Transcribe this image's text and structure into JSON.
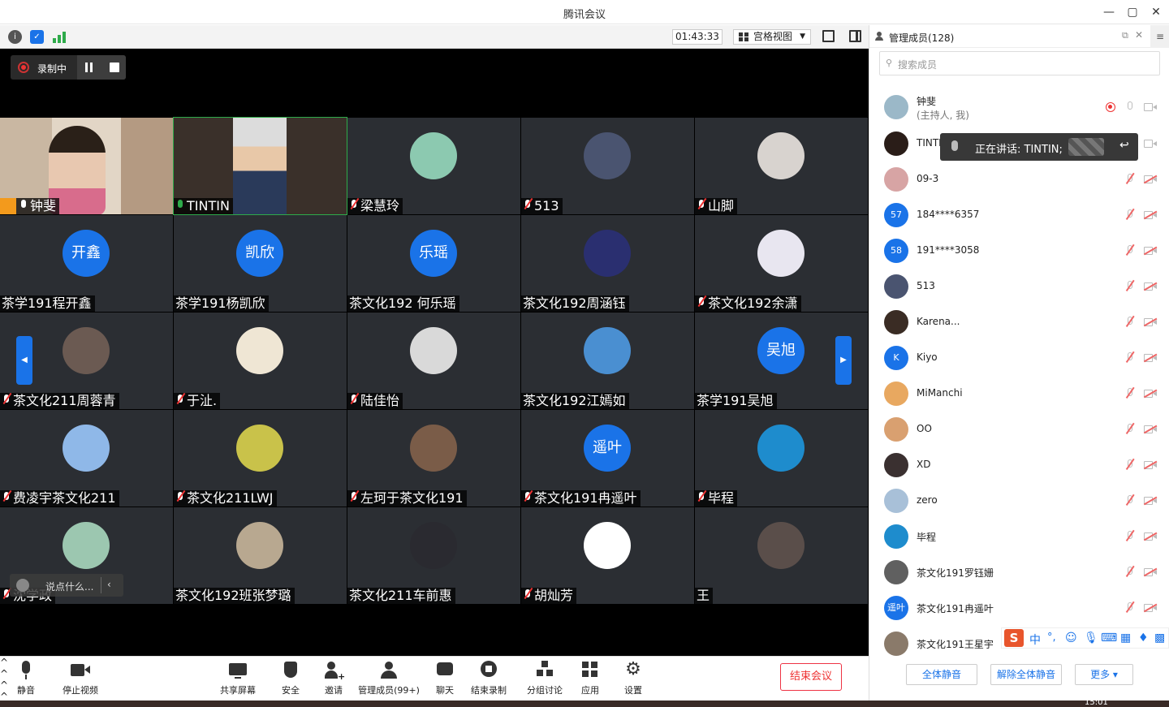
{
  "window": {
    "title": "腾讯会议",
    "controls": [
      "—",
      "▢",
      "✕"
    ]
  },
  "toolbar": {
    "timer": "01:43:33",
    "view_mode": "宫格视图"
  },
  "recording": {
    "label": "录制中"
  },
  "tiles": [
    {
      "name": "钟斐",
      "type": "video",
      "host": true,
      "mic": "on"
    },
    {
      "name": "TINTIN",
      "type": "video",
      "mic": "speaking",
      "active": true
    },
    {
      "name": "梁慧玲",
      "type": "photo",
      "color": "#8cc9b0",
      "mic": "muted"
    },
    {
      "name": "513",
      "type": "photo",
      "color": "#4a5470",
      "mic": "muted"
    },
    {
      "name": "山脚",
      "type": "photo",
      "color": "#d8d3cf",
      "mic": "muted"
    },
    {
      "name": "茶学191程开鑫",
      "type": "text",
      "avatar_text": "开鑫",
      "mic": "none"
    },
    {
      "name": "茶学191杨凯欣",
      "type": "text",
      "avatar_text": "凯欣",
      "mic": "none"
    },
    {
      "name": "茶文化192 何乐瑶",
      "type": "text",
      "avatar_text": "乐瑶",
      "mic": "none"
    },
    {
      "name": "茶文化192周涵钰",
      "type": "photo",
      "color": "#2a2f70",
      "mic": "none"
    },
    {
      "name": "茶文化192余潇",
      "type": "photo",
      "color": "#e8e6f0",
      "mic": "muted"
    },
    {
      "name": "茶文化211周蓉青",
      "type": "photo",
      "color": "#6b5a52",
      "mic": "muted"
    },
    {
      "name": "于沚.",
      "type": "photo",
      "color": "#efe6d4",
      "mic": "muted"
    },
    {
      "name": "陆佳怡",
      "type": "photo",
      "color": "#d9d9d9",
      "mic": "muted"
    },
    {
      "name": "茶文化192江嫣如",
      "type": "photo",
      "color": "#4a8fd1",
      "mic": "none"
    },
    {
      "name": "茶学191吴旭",
      "type": "text",
      "avatar_text": "吴旭",
      "mic": "none"
    },
    {
      "name": "费凌宇茶文化211",
      "type": "photo",
      "color": "#8fb8e8",
      "mic": "muted"
    },
    {
      "name": "茶文化211LWJ",
      "type": "photo",
      "color": "#c9c24a",
      "mic": "muted"
    },
    {
      "name": "左珂于茶文化191",
      "type": "photo",
      "color": "#7a5c48",
      "mic": "muted"
    },
    {
      "name": "茶文化191冉遥叶",
      "type": "text",
      "avatar_text": "遥叶",
      "mic": "muted"
    },
    {
      "name": "毕程",
      "type": "photo",
      "color": "#1e8ccd",
      "mic": "muted"
    },
    {
      "name": "沈学政",
      "type": "photo",
      "color": "#9cc7b0",
      "mic": "muted"
    },
    {
      "name": "茶文化192班张梦璐",
      "type": "photo",
      "color": "#b8a890",
      "mic": "none"
    },
    {
      "name": "茶文化211车前惠",
      "type": "photo",
      "color": "#2a2a30",
      "mic": "none"
    },
    {
      "name": "胡灿芳",
      "type": "photo",
      "color": "#ffffff",
      "mic": "muted"
    },
    {
      "name": "王",
      "type": "photo",
      "color": "#5a4e4a",
      "mic": "none"
    }
  ],
  "chat": {
    "placeholder": "说点什么..."
  },
  "bottombar": {
    "mute": "静音",
    "stop_video": "停止视频",
    "share": "共享屏幕",
    "security": "安全",
    "invite": "邀请",
    "members": "管理成员(99+)",
    "chat": "聊天",
    "end_record": "结束录制",
    "breakout": "分组讨论",
    "apps": "应用",
    "settings": "设置",
    "end_meeting": "结束会议"
  },
  "panel": {
    "title": "管理成员(128)",
    "search_placeholder": "搜索成员",
    "host": {
      "name": "钟斐",
      "role": "(主持人, 我)"
    },
    "speaking_tip": "正在讲话: TINTIN;",
    "members": [
      {
        "name": "TINTIN",
        "avatar": "",
        "color": "#2a1d18"
      },
      {
        "name": "09-3",
        "avatar": "",
        "color": "#d7a4a4"
      },
      {
        "name": "184****6357",
        "avatar": "57",
        "color": "#1a73e8"
      },
      {
        "name": "191****3058",
        "avatar": "58",
        "color": "#1a73e8"
      },
      {
        "name": "513",
        "avatar": "",
        "color": "#4a5470"
      },
      {
        "name": "Karena...",
        "avatar": "",
        "color": "#3a2c24"
      },
      {
        "name": "Kiyo",
        "avatar": "K",
        "color": "#1a73e8"
      },
      {
        "name": "MiManchi",
        "avatar": "",
        "color": "#e8a860"
      },
      {
        "name": "OO",
        "avatar": "",
        "color": "#d9a070"
      },
      {
        "name": "XD",
        "avatar": "",
        "color": "#3a3030"
      },
      {
        "name": "zero",
        "avatar": "",
        "color": "#a8c0d8"
      },
      {
        "name": "毕程",
        "avatar": "",
        "color": "#1e8ccd"
      },
      {
        "name": "茶文化191罗钰姗",
        "avatar": "",
        "color": "#606060"
      },
      {
        "name": "茶文化191冉遥叶",
        "avatar": "遥叶",
        "color": "#1a73e8"
      },
      {
        "name": "茶文化191王星宇",
        "avatar": "",
        "color": "#8a7a6a"
      }
    ],
    "buttons": {
      "mute_all": "全体静音",
      "unmute_all": "解除全体静音",
      "more": "更多 ▾"
    }
  },
  "ime": {
    "label": "中"
  },
  "taskbar_time": "15:01"
}
